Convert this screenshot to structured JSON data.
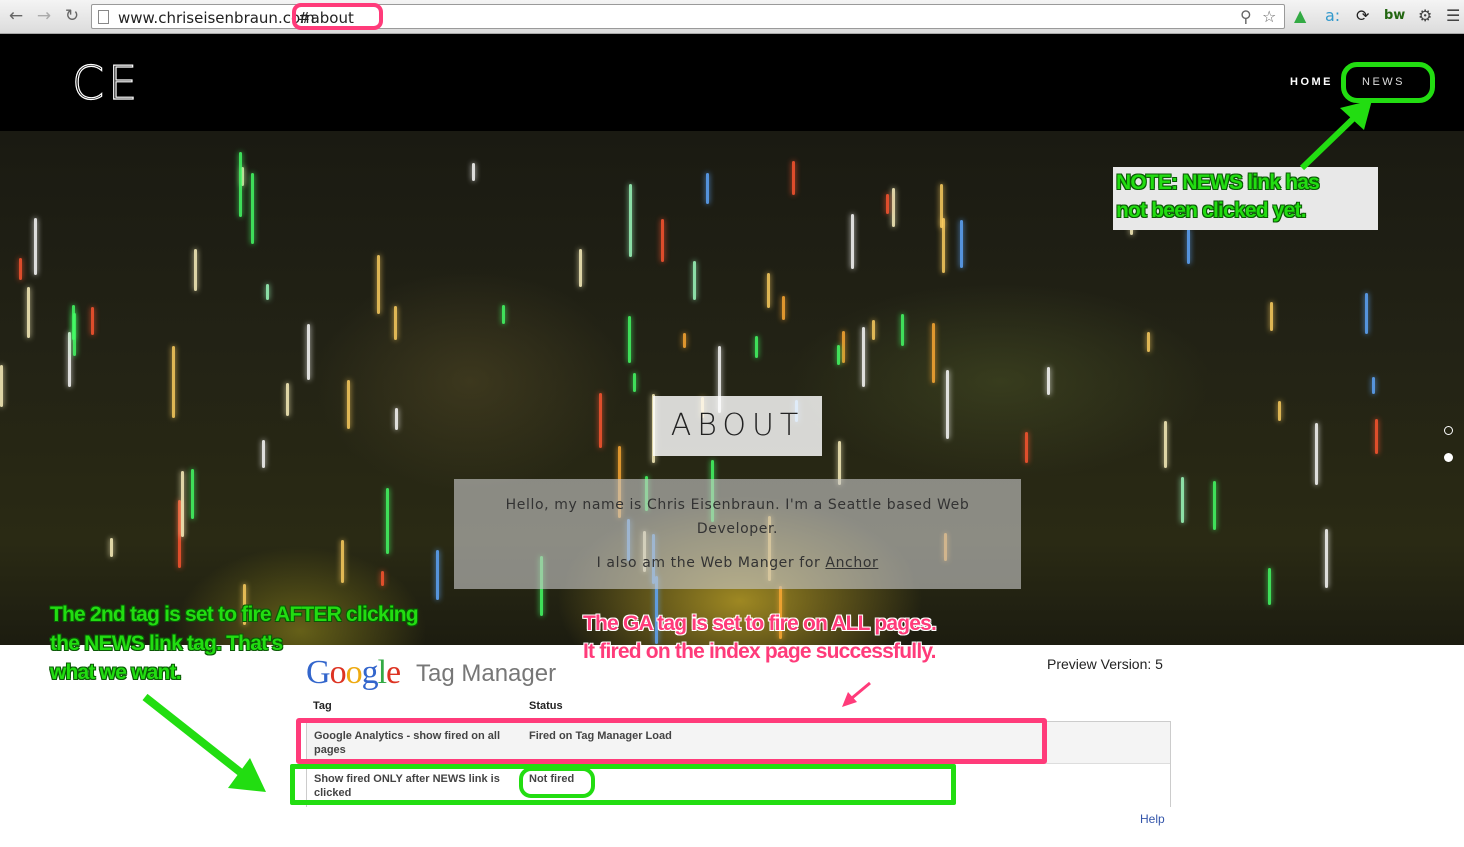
{
  "browser": {
    "url_host": "www.chriseisenbraun.com",
    "url_hash": "#about",
    "back_icon": "back-arrow-icon",
    "forward_icon": "forward-arrow-icon",
    "reload_icon": "reload-icon",
    "extensions": {
      "amazon": "a:",
      "bw": "bw"
    }
  },
  "site": {
    "logo": "CE",
    "nav": {
      "home": "HOME",
      "news": "NEWS"
    },
    "hero_title": "ABOUT",
    "intro_line1": "Hello, my name is Chris Eisenbraun. I'm a Seattle based Web Developer.",
    "intro_line2_prefix": "I also am the Web Manger for ",
    "intro_link": "Anchor"
  },
  "gtm": {
    "logo_letters": [
      "G",
      "o",
      "o",
      "g",
      "l",
      "e"
    ],
    "product": "Tag Manager",
    "preview_version": "Preview Version: 5",
    "headers": {
      "tag": "Tag",
      "status": "Status"
    },
    "rows": [
      {
        "tag": "Google Analytics - show fired on all pages",
        "status": "Fired on Tag Manager Load"
      },
      {
        "tag": "Show fired ONLY after NEWS link is clicked",
        "status": "Not fired"
      }
    ],
    "help": "Help"
  },
  "annotations": {
    "note_line1": "NOTE:  NEWS link has",
    "note_line2": "not been clicked yet.",
    "green_line1": "The 2nd tag is set to fire AFTER clicking",
    "green_line2": "the NEWS link tag. That's",
    "green_line3": "what we want.",
    "pink_line1": "The GA tag is set to fire on ALL pages.",
    "pink_line2": "It fired on the index page successfully."
  },
  "colors": {
    "highlight_pink": "#ff3b7a",
    "highlight_green": "#22dd11",
    "google_blue": "#3366cc",
    "google_red": "#dd3322",
    "google_yellow": "#eeaa11",
    "google_green": "#33aa44"
  }
}
